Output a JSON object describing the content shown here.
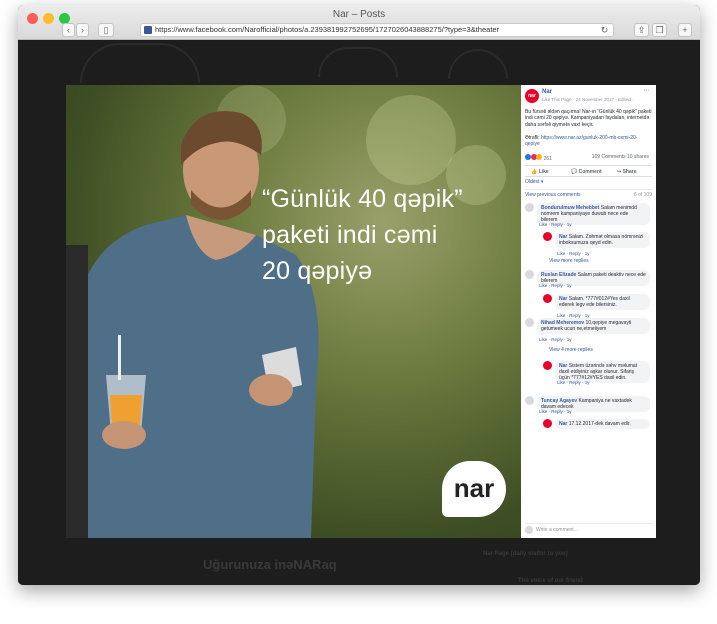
{
  "window": {
    "title": "Nar – Posts"
  },
  "browser": {
    "url": "https://www.facebook.com/Narofficial/photos/a.239381992752695/1727026043888275/?type=3&theater"
  },
  "photo": {
    "headline_line1": "“Günlük 40 qəpik”",
    "headline_line2": "paketi indi cəmi",
    "headline_line3": "20 qəpiyə",
    "logo_text": "nar"
  },
  "post": {
    "page_name": "Nar",
    "meta": "Like This Page · 24 November 2017 · Edited · ",
    "body": "Bu fürsəti əldən qaçırma! Nar-ın “Günlük 40 qəpik” paketi indi cəmi 20 qəpiyə. Kampaniyadan faydalan, internetdə daha sərfəli qiymətə vaxt keçir.",
    "traffic_label": "Ətrafli:",
    "traffic_link": "https://www.nar.az/gunluk-200-mb-cemi-20-qepiye",
    "reactions_count": "261",
    "comments_shares": "109 Comments  10 shares",
    "like_label": "Like",
    "comment_label": "Comment",
    "share_label": "Share",
    "sort_label": "Oldest ▾",
    "page_count": "6 of 109",
    "view_previous": "View previous comments"
  },
  "comments": [
    {
      "name": "Bondurulmuw Mehebbet",
      "text": "Salam menimdd nomrem kampaniyaye duwub nece ede bilerem",
      "actions": "Like · Reply · 1y"
    },
    {
      "name": "Nar",
      "text": "Salam. Zəhmət olmasa nömrənizi inboksumuza qeyd edin.",
      "actions": "Like · Reply · 1y",
      "reply": true
    },
    {
      "view_more": "View more replies"
    },
    {
      "name": "Ruslan Elizade",
      "text": "Salam paketi deaktiv nece ede bilerem",
      "actions": "Like · Reply · 1y"
    },
    {
      "name": "Nar",
      "text": "Salam. *777#012#Yes daxil ederek legv ede bilersiniz.",
      "actions": "Like · Reply · 1y",
      "reply": true
    },
    {
      "name": "Nihad Meheremov",
      "text": "10,qepiye megavayti getumeek ucun ne,etmeliyem",
      "actions": "Like · Reply · 1y"
    },
    {
      "view_more": "View 4 more replies"
    },
    {
      "name": "Nar",
      "text": "Sistem üzərində səhv məlumat daxil etdiyiniz aşkar olunur. Sifariş üçün *777#12#YES daxil edin.",
      "actions": "Like · Reply · 1y",
      "reply": true
    },
    {
      "name": "Tuncay Agayev",
      "text": "Kampaniya ne vaxtadek davam edecek",
      "actions": "Like · Reply · 1y"
    },
    {
      "name": "Nar",
      "text": "17.12.2017-dek davam edir.",
      "actions": "",
      "reply": true
    }
  ],
  "composer": {
    "placeholder": "Write a comment..."
  },
  "background": {
    "left_text": "Uğurunuza inəNARaq",
    "right_text1": "Nar Page (daily visitor to you)",
    "right_text2": "The voice of our friend"
  }
}
